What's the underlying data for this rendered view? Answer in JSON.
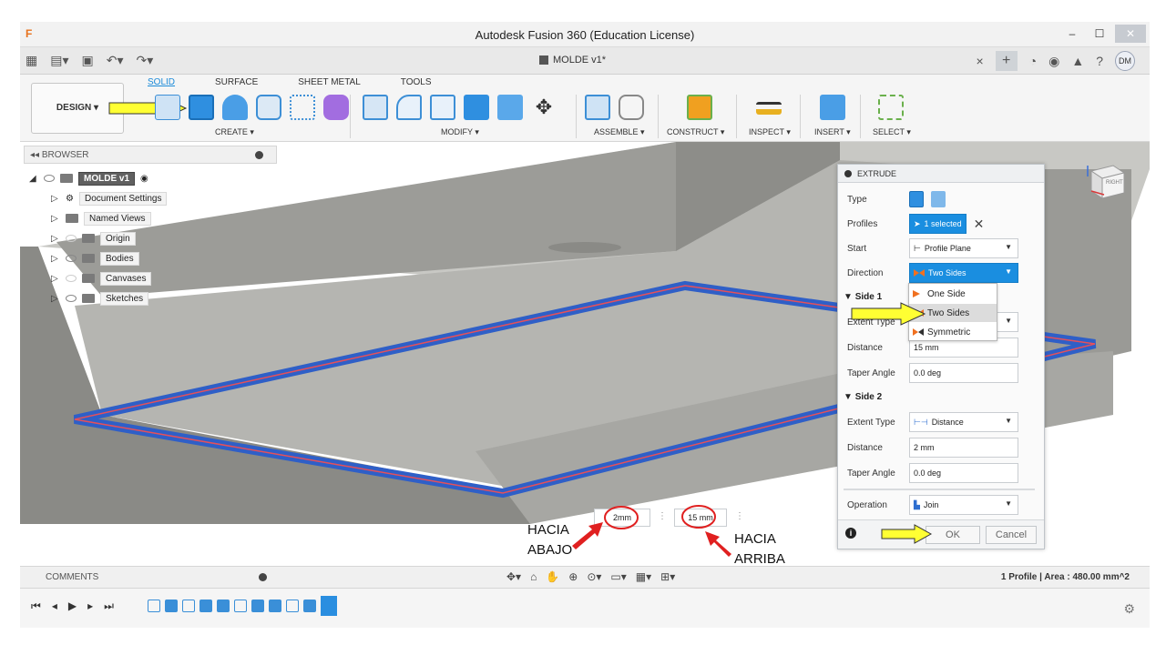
{
  "window": {
    "title": "Autodesk Fusion 360 (Education License)",
    "logo": "F"
  },
  "quickbar": {
    "doc_title": "MOLDE v1*",
    "close_tab": "×",
    "avatar": "DM"
  },
  "toolbar": {
    "workspace": "DESIGN ▾",
    "tabs": [
      "SOLID",
      "SURFACE",
      "SHEET METAL",
      "TOOLS"
    ],
    "groups": [
      "CREATE ▾",
      "MODIFY ▾",
      "ASSEMBLE ▾",
      "CONSTRUCT ▾",
      "INSPECT ▾",
      "INSERT ▾",
      "SELECT ▾"
    ]
  },
  "browser": {
    "header": "BROWSER",
    "root": "MOLDE v1",
    "items": [
      "Document Settings",
      "Named Views",
      "Origin",
      "Bodies",
      "Canvases",
      "Sketches"
    ]
  },
  "extrude": {
    "title": "EXTRUDE",
    "type_label": "Type",
    "profiles_label": "Profiles",
    "profiles_value": "1 selected",
    "start_label": "Start",
    "start_value": "Profile Plane",
    "direction_label": "Direction",
    "direction_value": "Two Sides",
    "side1": {
      "header": "Side 1",
      "extent_label": "Extent Type",
      "distance_label": "Distance",
      "distance_value": "15 mm",
      "taper_label": "Taper Angle",
      "taper_value": "0.0 deg"
    },
    "side2": {
      "header": "Side 2",
      "extent_label": "Extent Type",
      "extent_value": "Distance",
      "distance_label": "Distance",
      "distance_value": "2 mm",
      "taper_label": "Taper Angle",
      "taper_value": "0.0 deg"
    },
    "operation_label": "Operation",
    "operation_value": "Join",
    "ok": "OK",
    "cancel": "Cancel"
  },
  "direction_dropdown": {
    "options": [
      "One Side",
      "Two Sides",
      "Symmetric"
    ],
    "selected": "Two Sides"
  },
  "viewcube": {
    "face": "RIGHT"
  },
  "viewport_inputs": {
    "left": "2mm",
    "right": "15 mm"
  },
  "annotations": {
    "down_line1": "HACIA",
    "down_line2": "ABAJO",
    "up_line1": "HACIA",
    "up_line2": "ARRIBA"
  },
  "status": {
    "comments": "COMMENTS",
    "profile_info": "1 Profile | Area : 480.00 mm^2"
  },
  "colors": {
    "accent_blue": "#1a8ee0",
    "highlight_yellow": "#ffff33",
    "annotation_red": "#e02020",
    "model_gray": "#a3a3a0"
  },
  "icons": {
    "workspace": "design-icon",
    "view": "viewcube-icon"
  }
}
